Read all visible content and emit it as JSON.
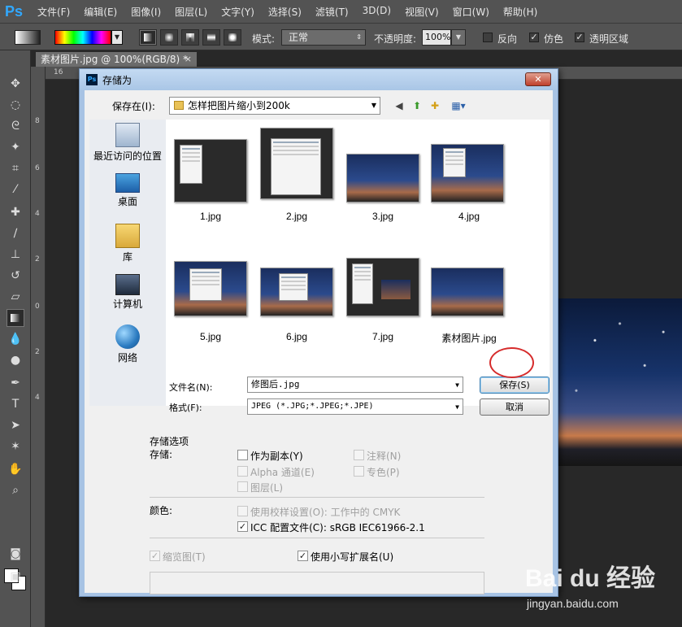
{
  "app": {
    "logo": "Ps",
    "menu": [
      "文件(F)",
      "编辑(E)",
      "图像(I)",
      "图层(L)",
      "文字(Y)",
      "选择(S)",
      "滤镜(T)",
      "3D(D)",
      "视图(V)",
      "窗口(W)",
      "帮助(H)"
    ]
  },
  "options": {
    "mode_label": "模式:",
    "mode_value": "正常",
    "opacity_label": "不透明度:",
    "opacity_value": "100%",
    "reverse_label": "反向",
    "dither_label": "仿色",
    "transparency_label": "透明区域"
  },
  "document": {
    "tab_title": "素材图片.jpg @ 100%(RGB/8) *",
    "ruler_h": [
      "16"
    ],
    "ruler_v": [
      "8",
      "6",
      "4",
      "2",
      "0",
      "2",
      "4"
    ]
  },
  "dialog": {
    "title": "存储为",
    "close_label": "✕",
    "save_in_label": "保存在(I):",
    "folder": "怎样把图片缩小到200k",
    "places": [
      "最近访问的位置",
      "桌面",
      "库",
      "计算机",
      "网络"
    ],
    "files": [
      "1.jpg",
      "2.jpg",
      "3.jpg",
      "4.jpg",
      "5.jpg",
      "6.jpg",
      "7.jpg",
      "素材图片.jpg"
    ],
    "filename_label": "文件名(N):",
    "filename_value": "修图后.jpg",
    "format_label": "格式(F):",
    "format_value": "JPEG (*.JPG;*.JPEG;*.JPE)",
    "save_button": "保存(S)",
    "cancel_button": "取消",
    "save_options_title": "存储选项",
    "store_label": "存储:",
    "as_copy": "作为副本(Y)",
    "notes": "注释(N)",
    "alpha": "Alpha 通道(E)",
    "spot": "专色(P)",
    "layers": "图层(L)",
    "color_label": "颜色:",
    "proof": "使用校样设置(O): 工作中的 CMYK",
    "icc": "ICC 配置文件(C): sRGB IEC61966-2.1",
    "thumbnail": "缩览图(T)",
    "lowercase_ext": "使用小写扩展名(U)"
  },
  "watermark": {
    "logo": "Bai du 经验",
    "url": "jingyan.baidu.com"
  }
}
